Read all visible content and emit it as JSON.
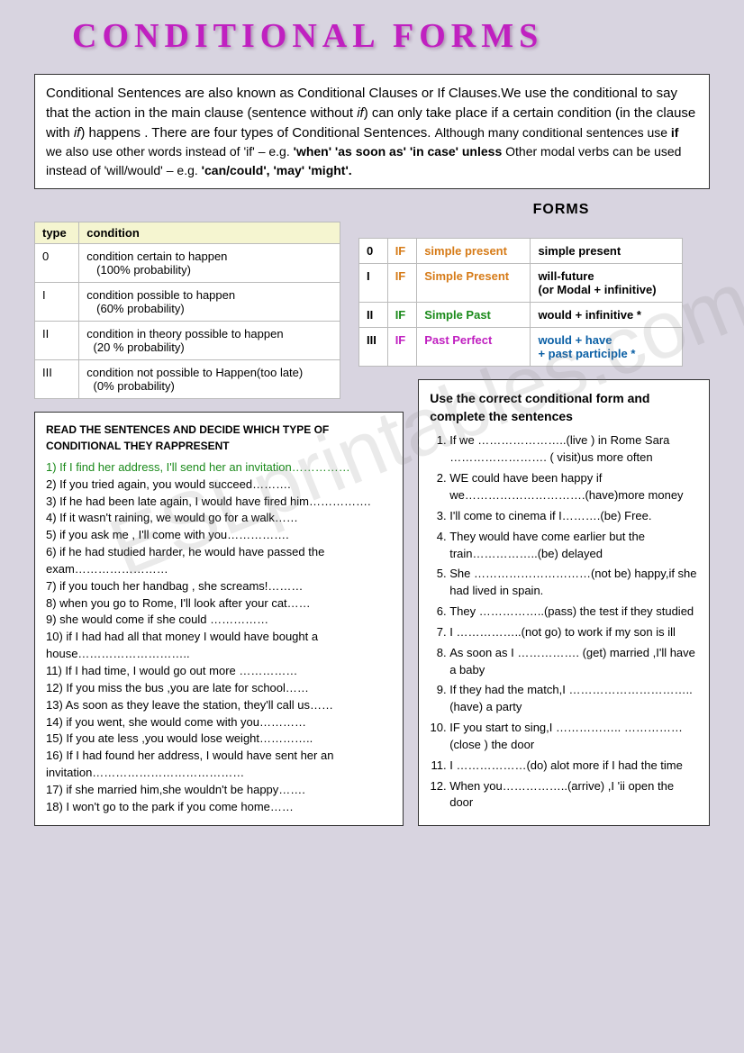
{
  "title": "CONDITIONAL FORMS",
  "watermark": "ESLprintables.com",
  "intro": {
    "main": "Conditional Sentences are also known as Conditional Clauses or If Clauses.We use the conditional to say   that the action in the main clause (sentence without ",
    "if1": "if",
    "main2": ") can only take place if a certain condition (in the clause with ",
    "if2": "if",
    "main3": ") happens . There are four  types of Conditional Sentences. ",
    "small1": "Although many conditional sentences use ",
    "ifb": "if",
    "small2": " we  also use other words instead of 'if' – e.g. ",
    "words": "'when' 'as soon as' 'in case' unless",
    "small3": "  Other modal verbs can be used instead of 'will/would' – e.g. ",
    "modals": "'can/could', 'may' 'might'.",
    "end": ""
  },
  "forms_heading": "FORMS",
  "type_table": {
    "h1": "type",
    "h2": "condition",
    "rows": [
      {
        "t": "0",
        "c": "condition certain to happen",
        "p": "(100% probability)"
      },
      {
        "t": "I",
        "c": "condition possible to happen",
        "p": "(60% probability)"
      },
      {
        "t": "II",
        "c": "condition in theory possible to happen",
        "p": "(20 % probability)"
      },
      {
        "t": "III",
        "c": "condition not possible to Happen(too late)",
        "p": "(0% probability)"
      }
    ]
  },
  "forms_table": {
    "rows": [
      {
        "t": "0",
        "if": "IF",
        "a": "simple present",
        "b": "simple present",
        "ac": "c-orange",
        "bc": ""
      },
      {
        "t": "I",
        "if": "IF",
        "a": "Simple Present",
        "b": "will-future\n (or Modal + infinitive)",
        "ac": "c-orange",
        "bc": ""
      },
      {
        "t": "II",
        "if": "IF",
        "a": "Simple Past",
        "b": "would + infinitive *",
        "ac": "c-green",
        "bc": ""
      },
      {
        "t": "III",
        "if": "IF",
        "a": "Past Perfect",
        "b": "would + have\n + past participle *",
        "ac": "c-magenta",
        "bc": "c-blue"
      }
    ]
  },
  "ex_left": {
    "heading": "READ THE SENTENCES AND DECIDE WHICH TYPE OF CONDITIONAL THEY RAPPRESENT",
    "items": [
      {
        "n": "1)",
        "text": "If I find her address, I'll send her an invitation……………",
        "green": true
      },
      {
        "n": "2)",
        "text": "If you tried again, you would succeed………."
      },
      {
        "n": "3)",
        "text": "If he had been late again, I would have fired him……………."
      },
      {
        "n": "4)",
        "text": "If it wasn't raining, we would go for a walk……"
      },
      {
        "n": "5)",
        "text": "if you ask me , I'll come with you……………."
      },
      {
        "n": "6)",
        "text": "if he had studied harder, he would have passed the exam……………………"
      },
      {
        "n": "7)",
        "text": "if you touch her handbag  , she screams!………"
      },
      {
        "n": "8)",
        "text": "when you go to Rome, I'll look after your cat……"
      },
      {
        "n": "9)",
        "text": "she would come if she could ……………"
      },
      {
        "n": "10)",
        "text": "if I had had all that money I would have bought a house……………………….."
      },
      {
        "n": "11)",
        "text": "If I had time, I would go out more ……………"
      },
      {
        "n": "12)",
        "text": "If you miss the bus ,you are late for school……"
      },
      {
        "n": "13)",
        "text": "As soon as they leave the station, they'll call us……"
      },
      {
        "n": "14)",
        "text": "if you went, she would come with you…………"
      },
      {
        "n": "15)",
        "text": "If you ate less ,you would lose weight………….."
      },
      {
        "n": "16)",
        "text": "If I had found her address, I would have sent her an invitation…………………………………"
      },
      {
        "n": "17)",
        "text": "if she married him,she wouldn't be happy……."
      },
      {
        "n": "18)",
        "text": "I won't go to the park if you come home……"
      }
    ]
  },
  "ex_right": {
    "heading": "Use the correct  conditional form and complete the sentences",
    "items": [
      "If we …………………..(live ) in Rome Sara ……………………. ( visit)us more often",
      "WE could have been happy if we………………………….(have)more money",
      "I'll come to cinema if  I……….(be) Free.",
      "They would have come earlier but the train……………..(be) delayed",
      "She …………………………(not be) happy,if she had lived in spain.",
      "They ……………..(pass) the test if they studied",
      " I ……………..(not go) to work if my son is ill",
      "As soon as I ……………. (get) married ,I'll have a baby",
      "If they had the match,I …………………………..(have) a party",
      "IF you start to sing,I …………….. ……………(close ) the door",
      "I ………………(do) alot more if I had the time",
      "When you……………..(arrive) ,I 'ii open the door"
    ]
  }
}
